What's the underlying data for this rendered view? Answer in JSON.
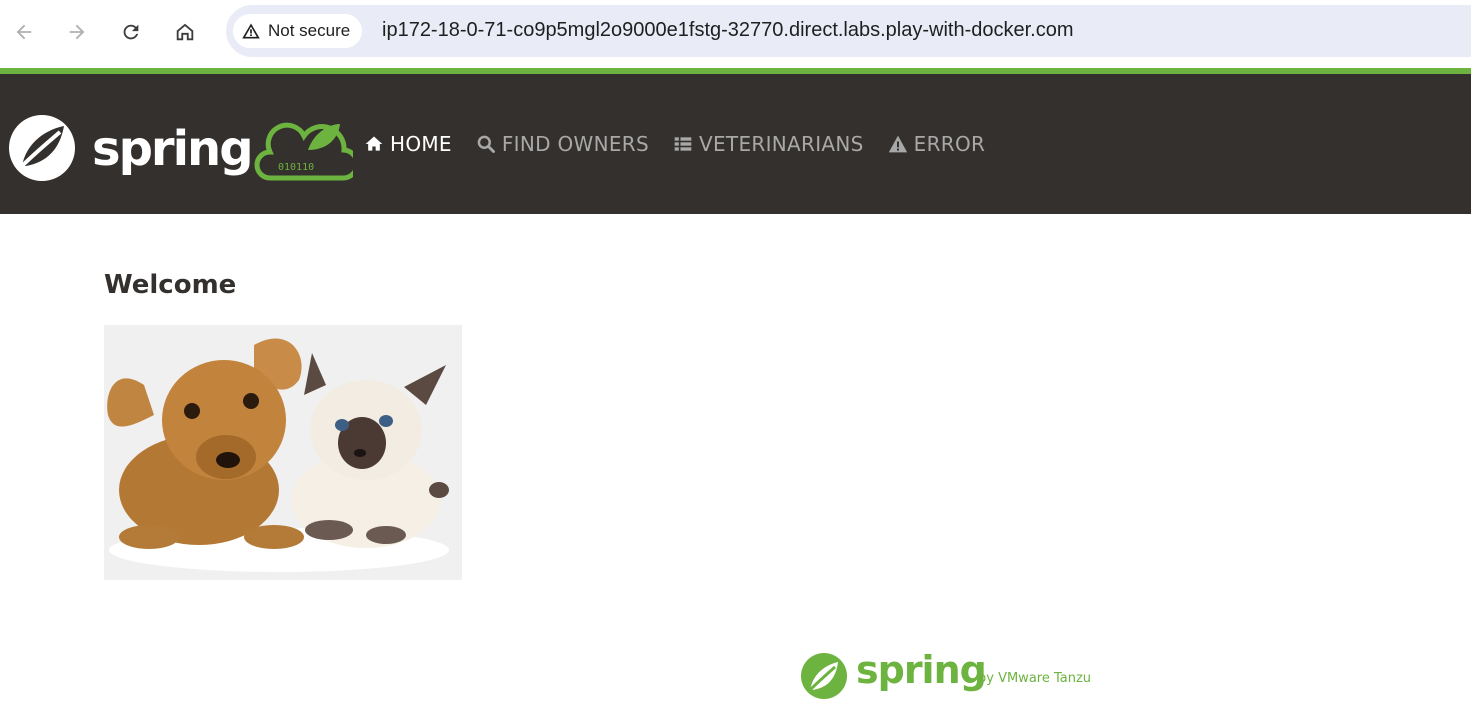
{
  "browser": {
    "security_label": "Not secure",
    "url": "ip172-18-0-71-co9p5mgl2o9000e1fstg-32770.direct.labs.play-with-docker.com"
  },
  "navbar": {
    "brand_text": "spring",
    "brand_binary": "010110",
    "items": [
      {
        "label": "HOME",
        "icon": "home-icon",
        "active": true
      },
      {
        "label": "FIND OWNERS",
        "icon": "search-icon",
        "active": false
      },
      {
        "label": "VETERINARIANS",
        "icon": "list-icon",
        "active": false
      },
      {
        "label": "ERROR",
        "icon": "warning-icon",
        "active": false
      }
    ]
  },
  "main": {
    "title": "Welcome",
    "image_subject": "puppy and kitten"
  },
  "footer": {
    "wordmark": "spring",
    "byline": "by VMware Tanzu"
  },
  "colors": {
    "brand_green": "#6db33f",
    "navbar_bg": "#34302d",
    "nav_inactive": "#a8a8a8",
    "nav_active": "#ffffff"
  }
}
